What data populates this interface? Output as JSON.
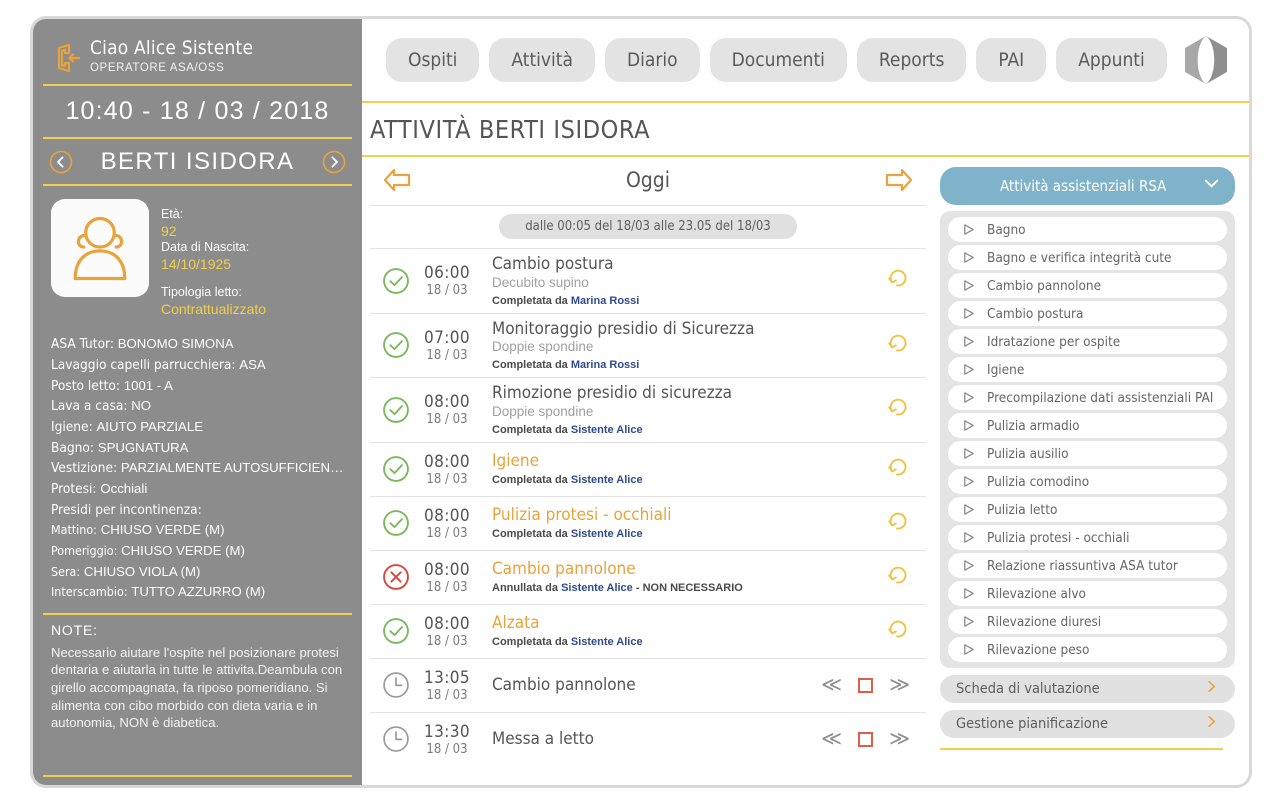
{
  "sidebar": {
    "logout_icon": "logout-icon",
    "greeting": "Ciao Alice Sistente",
    "role": "OPERATORE ASA/OSS",
    "clock": "10:40 - 18 / 03 / 2018",
    "prev_icon": "chevron-left-circle-icon",
    "next_icon": "chevron-right-circle-icon",
    "patient_name": "BERTI ISIDORA",
    "avatar_icon": "person-avatar-icon",
    "meta": {
      "age_label": "Età:",
      "age_value": "92",
      "birth_label": " Data di Nascita:",
      "birth_value": "14/10/1925",
      "bed_label": "Tipologia letto:",
      "bed_value": "Contrattualizzato"
    },
    "fields": [
      {
        "label": "ASA Tutor:",
        "value": "BONOMO SIMONA"
      },
      {
        "label": "Lavaggio capelli parrucchiera:",
        "value": "ASA"
      },
      {
        "label": "Posto letto:",
        "value": "1001 - A"
      },
      {
        "label": "Lava a casa:",
        "value": "NO"
      },
      {
        "label": "Igiene:",
        "value": "AIUTO PARZIALE"
      },
      {
        "label": "Bagno:",
        "value": "SPUGNATURA"
      },
      {
        "label": "Vestizione:",
        "value": "PARZIALMENTE AUTOSUFFICIENTE"
      },
      {
        "label": "Protesi:",
        "value": "Occhiali"
      },
      {
        "label": "Presidi per incontinenza:",
        "value": ""
      },
      {
        "label": "Mattino:",
        "value": "CHIUSO VERDE (M)"
      },
      {
        "label": "Pomeriggio:",
        "value": "CHIUSO VERDE (M)"
      },
      {
        "label": "Sera:",
        "value": " CHIUSO VIOLA (M)"
      },
      {
        "label": "Interscambio:",
        "value": "TUTTO AZZURRO (M)"
      }
    ],
    "note_title": "NOTE:",
    "note_text": "Necessario aiutare l'ospite nel posizionare protesi dentaria e aiutarla in tutte le attivita.Deambula con girello accompagnata, fa riposo pomeridiano. Si alimenta con cibo morbido con dieta varia e in autonomia, NON è diabetica."
  },
  "topnav": {
    "tabs": [
      {
        "label": "Ospiti"
      },
      {
        "label": "Attività"
      },
      {
        "label": "Diario"
      },
      {
        "label": "Documenti"
      },
      {
        "label": "Reports"
      },
      {
        "label": "PAI"
      },
      {
        "label": "Appunti"
      }
    ],
    "logo_icon": "hexagon-logo-icon"
  },
  "page_title": "ATTIVITÀ BERTI ISIDORA",
  "day_bar": {
    "prev_icon": "arrow-left-icon",
    "label": "Oggi",
    "next_icon": "arrow-right-icon",
    "range_chip": "dalle 00:05 del 18/03 alle 23.05 del 18/03"
  },
  "activities": [
    {
      "status": "completed",
      "status_icon": "check-circle-icon",
      "time": "06:00",
      "date": "18 / 03",
      "title": "Cambio postura",
      "title_color": "gray",
      "subtitle": "Decubito supino",
      "by_prefix": "Completata da ",
      "by_who": "Marina Rossi",
      "by_suffix": "",
      "action_icon": "undo-circular-arrow-icon"
    },
    {
      "status": "completed",
      "status_icon": "check-circle-icon",
      "time": "07:00",
      "date": "18 / 03",
      "title": "Monitoraggio presidio di Sicurezza",
      "title_color": "gray",
      "subtitle": "Doppie spondine",
      "by_prefix": "Completata da ",
      "by_who": "Marina Rossi",
      "by_suffix": "",
      "action_icon": "undo-circular-arrow-icon"
    },
    {
      "status": "completed",
      "status_icon": "check-circle-icon",
      "time": "08:00",
      "date": "18 / 03",
      "title": "Rimozione presidio di sicurezza",
      "title_color": "gray",
      "subtitle": "Doppie spondine",
      "by_prefix": "Completata da ",
      "by_who": "Sistente Alice",
      "by_suffix": "",
      "action_icon": "undo-circular-arrow-icon"
    },
    {
      "status": "completed",
      "status_icon": "check-circle-icon",
      "time": "08:00",
      "date": "18 / 03",
      "title": "Igiene",
      "title_color": "orange",
      "subtitle": "",
      "by_prefix": "Completata da ",
      "by_who": "Sistente Alice",
      "by_suffix": "",
      "action_icon": "undo-circular-arrow-icon"
    },
    {
      "status": "completed",
      "status_icon": "check-circle-icon",
      "time": "08:00",
      "date": "18 / 03",
      "title": "Pulizia protesi - occhiali",
      "title_color": "orange",
      "subtitle": "",
      "by_prefix": "Completata da ",
      "by_who": "Sistente Alice",
      "by_suffix": "",
      "action_icon": "undo-circular-arrow-icon"
    },
    {
      "status": "cancelled",
      "status_icon": "x-circle-icon",
      "time": "08:00",
      "date": "18 / 03",
      "title": "Cambio pannolone",
      "title_color": "orange",
      "subtitle": "",
      "by_prefix": "Annullata da ",
      "by_who": "Sistente Alice",
      "by_suffix": " - NON NECESSARIO",
      "action_icon": "undo-circular-arrow-icon"
    },
    {
      "status": "completed",
      "status_icon": "check-circle-icon",
      "time": "08:00",
      "date": "18 / 03",
      "title": "Alzata",
      "title_color": "orange",
      "subtitle": "",
      "by_prefix": "Completata da ",
      "by_who": "Sistente Alice",
      "by_suffix": "",
      "action_icon": "undo-circular-arrow-icon"
    },
    {
      "status": "pending",
      "status_icon": "clock-icon",
      "time": "13:05",
      "date": "18 / 03",
      "title": "Cambio pannolone",
      "title_color": "gray",
      "subtitle": "",
      "by_prefix": "",
      "by_who": "",
      "by_suffix": "",
      "prev_icon": "double-chevron-left-icon",
      "checkbox_icon": "checkbox-empty-icon",
      "next_icon": "double-chevron-right-icon"
    },
    {
      "status": "pending",
      "status_icon": "clock-icon",
      "time": "13:30",
      "date": "18 / 03",
      "title": "Messa a letto",
      "title_color": "gray",
      "subtitle": "",
      "by_prefix": "",
      "by_who": "",
      "by_suffix": "",
      "prev_icon": "double-chevron-left-icon",
      "checkbox_icon": "checkbox-empty-icon",
      "next_icon": "double-chevron-right-icon"
    }
  ],
  "right_panel": {
    "header_label": "Attività assistenziali RSA",
    "header_chevron_icon": "chevron-down-icon",
    "items": [
      {
        "label": "Bagno",
        "icon": "play-triangle-icon"
      },
      {
        "label": "Bagno e verifica integrità cute",
        "icon": "play-triangle-icon"
      },
      {
        "label": "Cambio pannolone",
        "icon": "play-triangle-icon"
      },
      {
        "label": "Cambio postura",
        "icon": "play-triangle-icon"
      },
      {
        "label": "Idratazione per ospite",
        "icon": "play-triangle-icon"
      },
      {
        "label": "Igiene",
        "icon": "play-triangle-icon"
      },
      {
        "label": "Precompilazione dati assistenziali PAI",
        "icon": "play-triangle-icon"
      },
      {
        "label": "Pulizia armadio",
        "icon": "play-triangle-icon"
      },
      {
        "label": "Pulizia ausilio",
        "icon": "play-triangle-icon"
      },
      {
        "label": "Pulizia comodino",
        "icon": "play-triangle-icon"
      },
      {
        "label": "Pulizia letto",
        "icon": "play-triangle-icon"
      },
      {
        "label": "Pulizia protesi - occhiali",
        "icon": "play-triangle-icon"
      },
      {
        "label": "Relazione riassuntiva ASA tutor",
        "icon": "play-triangle-icon"
      },
      {
        "label": "Rilevazione alvo",
        "icon": "play-triangle-icon"
      },
      {
        "label": "Rilevazione diuresi",
        "icon": "play-triangle-icon"
      },
      {
        "label": "Rilevazione peso",
        "icon": "play-triangle-icon"
      }
    ],
    "footer_buttons": [
      {
        "label": "Scheda di valutazione",
        "icon": "chevron-right-icon"
      },
      {
        "label": "Gestione pianificazione",
        "icon": "chevron-right-icon"
      }
    ]
  },
  "colors": {
    "accent_yellow": "#f0cf4a",
    "accent_orange": "#e8a33d",
    "sidebar_gray": "#8c8c8c",
    "panel_blue": "#7fb3ca",
    "status_green": "#7ab85c",
    "status_red": "#d8453c",
    "link_blue": "#2f4b8f"
  }
}
